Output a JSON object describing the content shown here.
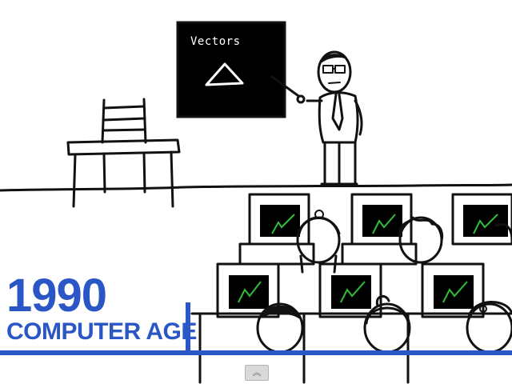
{
  "blackboard": {
    "text": "Vectors"
  },
  "caption": {
    "year": "1990",
    "title": "COMPUTER AGE"
  },
  "colors": {
    "accent": "#2a56c6",
    "screen_line": "#2fbf3a",
    "ink": "#111111",
    "board": "#000000"
  },
  "controls": {
    "scroll_up_icon": "double-chevron-up-icon",
    "scroll_glyph": "︽"
  }
}
